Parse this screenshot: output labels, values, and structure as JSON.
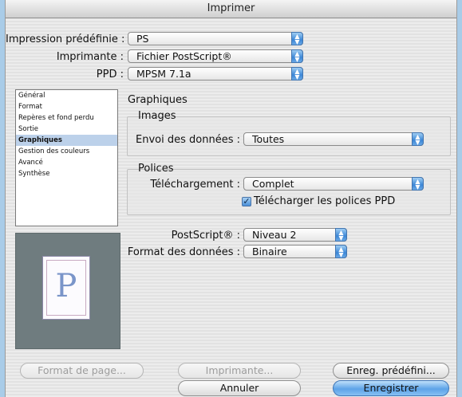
{
  "window": {
    "title": "Imprimer"
  },
  "presets": {
    "label": "Impression prédéfinie :",
    "value": "PS"
  },
  "printer": {
    "label": "Imprimante :",
    "value": "Fichier PostScript®"
  },
  "ppd": {
    "label": "PPD :",
    "value": "MPSM 7.1a"
  },
  "sidebar": {
    "items": [
      {
        "label": "Général"
      },
      {
        "label": "Format"
      },
      {
        "label": "Repères et fond perdu"
      },
      {
        "label": "Sortie"
      },
      {
        "label": "Graphiques",
        "selected": true
      },
      {
        "label": "Gestion des couleurs"
      },
      {
        "label": "Avancé"
      },
      {
        "label": "Synthèse"
      }
    ]
  },
  "panel": {
    "title": "Graphiques",
    "images": {
      "group_title": "Images",
      "send_data_label": "Envoi des données :",
      "send_data_value": "Toutes"
    },
    "fonts": {
      "group_title": "Polices",
      "download_label": "Téléchargement :",
      "download_value": "Complet",
      "ppd_fonts_checkbox_label": "Télécharger les polices PPD",
      "ppd_fonts_checked": true
    },
    "postscript": {
      "label": "PostScript® :",
      "value": "Niveau 2"
    },
    "data_format": {
      "label": "Format des données :",
      "value": "Binaire"
    }
  },
  "preview": {
    "page_letter": "P"
  },
  "buttons": {
    "page_setup": "Format de page...",
    "printer": "Imprimante...",
    "save_preset": "Enreg. prédéfini...",
    "cancel": "Annuler",
    "save": "Enregistrer"
  },
  "icons": {
    "stepper": "popup-stepper-icon",
    "check": "check-icon"
  },
  "colors": {
    "accent": "#5da3e8",
    "selection": "#bcd1ea",
    "preview_bg": "#6f7c7f"
  }
}
